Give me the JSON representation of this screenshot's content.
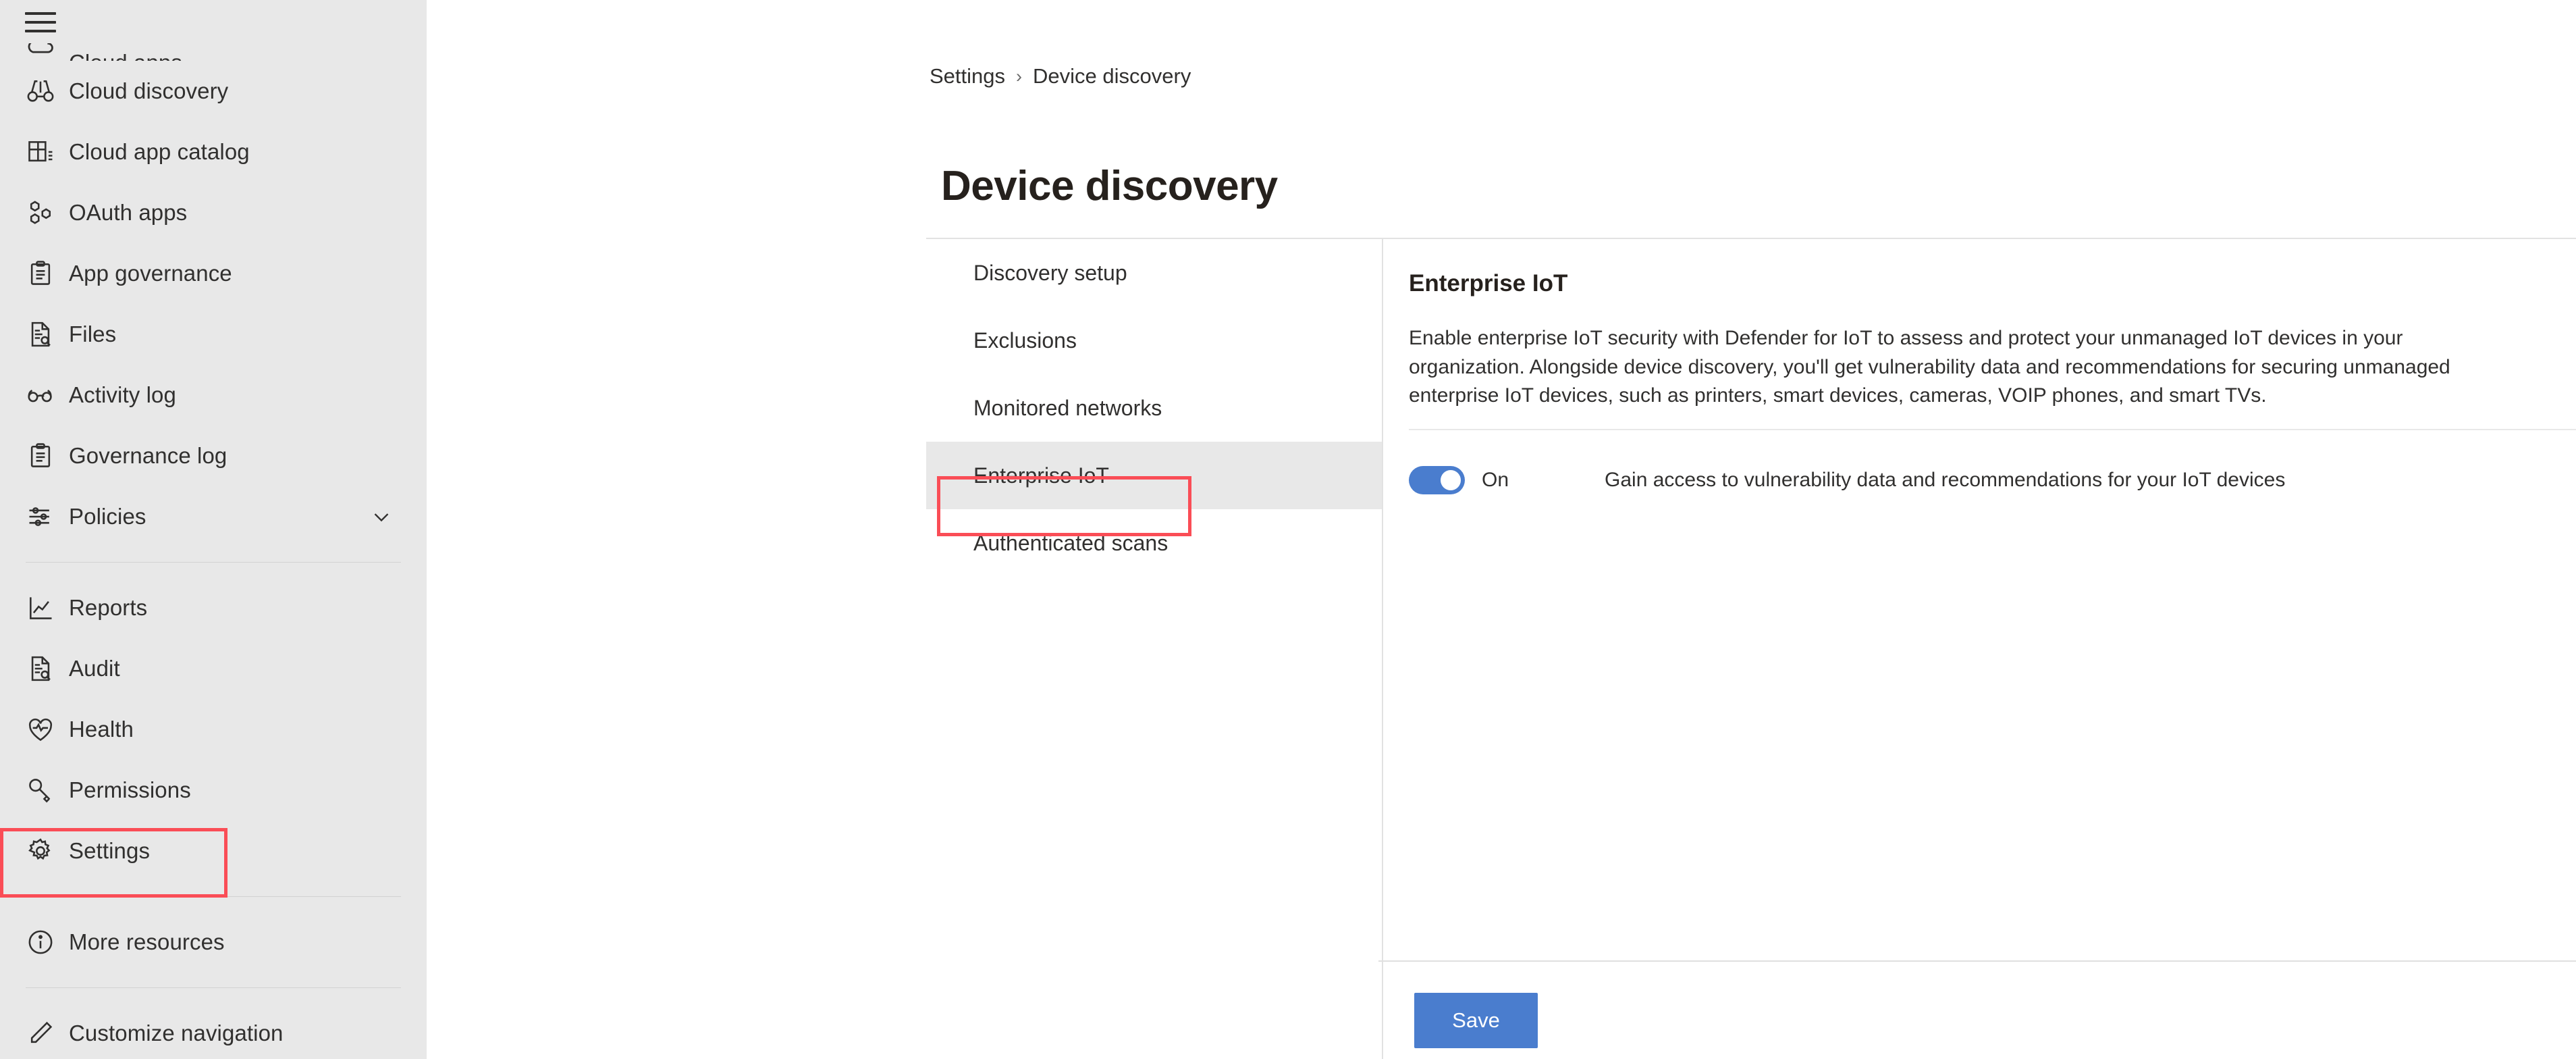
{
  "sidebar": {
    "menu_icon": "hamburger-icon",
    "items": [
      {
        "label": "Cloud apps",
        "icon": "cloud-apps-icon",
        "clipped": true,
        "chevron": false
      },
      {
        "label": "Cloud discovery",
        "icon": "binoculars-icon",
        "clipped": false,
        "chevron": false
      },
      {
        "label": "Cloud app catalog",
        "icon": "catalog-grid-icon",
        "clipped": false,
        "chevron": false
      },
      {
        "label": "OAuth apps",
        "icon": "hexagons-icon",
        "clipped": false,
        "chevron": false
      },
      {
        "label": "App governance",
        "icon": "clipboard-icon",
        "clipped": false,
        "chevron": false
      },
      {
        "label": "Files",
        "icon": "file-search-icon",
        "clipped": false,
        "chevron": false
      },
      {
        "label": "Activity log",
        "icon": "glasses-icon",
        "clipped": false,
        "chevron": false
      },
      {
        "label": "Governance log",
        "icon": "clipboard-icon",
        "clipped": false,
        "chevron": false
      },
      {
        "label": "Policies",
        "icon": "sliders-icon",
        "clipped": false,
        "chevron": true
      }
    ],
    "items_group2": [
      {
        "label": "Reports",
        "icon": "chart-line-icon"
      },
      {
        "label": "Audit",
        "icon": "file-search-icon"
      },
      {
        "label": "Health",
        "icon": "heart-pulse-icon"
      },
      {
        "label": "Permissions",
        "icon": "key-icon"
      },
      {
        "label": "Settings",
        "icon": "gear-icon"
      }
    ],
    "items_group3": [
      {
        "label": "More resources",
        "icon": "info-circle-icon"
      }
    ],
    "items_group4": [
      {
        "label": "Customize navigation",
        "icon": "pencil-icon"
      }
    ]
  },
  "breadcrumb": {
    "root": "Settings",
    "separator": "›",
    "current": "Device discovery"
  },
  "page": {
    "title": "Device discovery"
  },
  "subnav": {
    "items": [
      {
        "label": "Discovery setup",
        "active": false
      },
      {
        "label": "Exclusions",
        "active": false
      },
      {
        "label": "Monitored networks",
        "active": false
      },
      {
        "label": "Enterprise IoT",
        "active": true
      },
      {
        "label": "Authenticated scans",
        "active": false
      }
    ]
  },
  "detail": {
    "title": "Enterprise IoT",
    "description": "Enable enterprise IoT security with Defender for IoT to assess and protect your unmanaged IoT devices in your organization. Alongside device discovery, you'll get vulnerability data and recommendations for securing unmanaged enterprise IoT devices, such as printers, smart devices, cameras, VOIP phones, and smart TVs.",
    "toggle_state": "On",
    "toggle_checked": true,
    "toggle_description": "Gain access to vulnerability data and recommendations for your IoT devices",
    "save_label": "Save"
  },
  "colors": {
    "accent_blue": "#4a7dce",
    "sidebar_bg": "#e8e8e8",
    "highlight_red": "#fa4d56",
    "text": "#31302f",
    "divider": "#e2e2e2"
  }
}
